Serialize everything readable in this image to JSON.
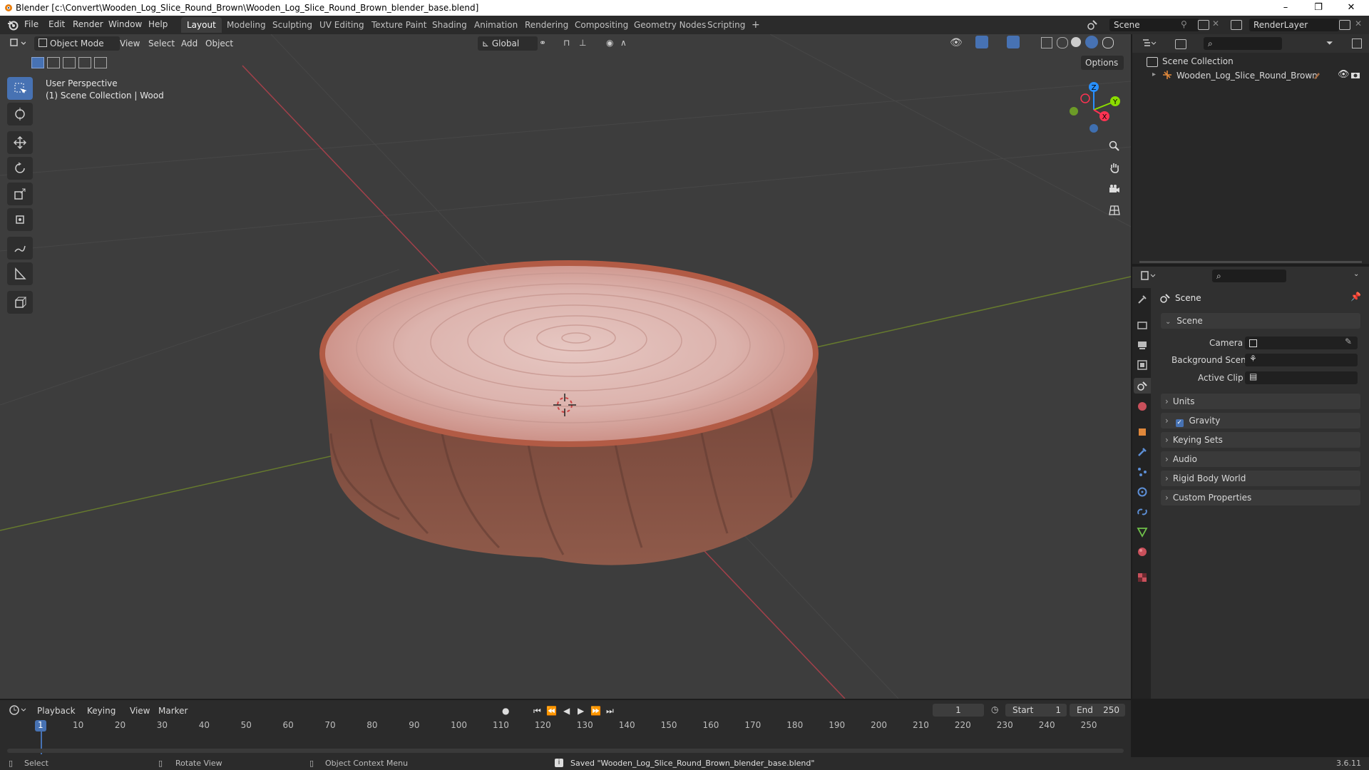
{
  "window": {
    "title": "Blender [c:\\Convert\\Wooden_Log_Slice_Round_Brown\\Wooden_Log_Slice_Round_Brown_blender_base.blend]",
    "minimize": "–",
    "maximize": "❐",
    "close": "✕"
  },
  "menu": [
    "File",
    "Edit",
    "Render",
    "Window",
    "Help"
  ],
  "workspaces": [
    "Layout",
    "Modeling",
    "Sculpting",
    "UV Editing",
    "Texture Paint",
    "Shading",
    "Animation",
    "Rendering",
    "Compositing",
    "Geometry Nodes",
    "Scripting"
  ],
  "workspace_add": "+",
  "scene_name": "Scene",
  "render_layer": "RenderLayer",
  "viewport": {
    "mode": "Object Mode",
    "menus": [
      "View",
      "Select",
      "Add",
      "Object"
    ],
    "transform_orientation": "Global",
    "options": "Options",
    "overlay_line1": "User Perspective",
    "overlay_line2": "(1) Scene Collection | Wood",
    "gizmo": {
      "x": "X",
      "y": "Y",
      "z": "Z"
    }
  },
  "outliner": {
    "collection": "Scene Collection",
    "object": "Wooden_Log_Slice_Round_Brown"
  },
  "properties": {
    "header": "Scene",
    "section": "Scene",
    "fields": [
      {
        "label": "Camera"
      },
      {
        "label": "Background Scene"
      },
      {
        "label": "Active Clip"
      }
    ],
    "panels": [
      "Units",
      "Gravity",
      "Keying Sets",
      "Audio",
      "Rigid Body World",
      "Custom Properties"
    ]
  },
  "timeline": {
    "menus": [
      "Playback",
      "Keying",
      "View",
      "Marker"
    ],
    "current_frame": "1",
    "start_label": "Start",
    "start": "1",
    "end_label": "End",
    "end": "250",
    "ruler": [
      "1",
      "10",
      "20",
      "30",
      "40",
      "50",
      "60",
      "70",
      "80",
      "90",
      "100",
      "110",
      "120",
      "130",
      "140",
      "150",
      "160",
      "170",
      "180",
      "190",
      "200",
      "210",
      "220",
      "230",
      "240",
      "250"
    ]
  },
  "statusbar": {
    "select": "Select",
    "rotate": "Rotate View",
    "context": "Object Context Menu",
    "message": "Saved \"Wooden_Log_Slice_Round_Brown_blender_base.blend\"",
    "version": "3.6.11"
  },
  "colors": {
    "accent": "#4772b3",
    "x_axis": "#ff3352",
    "y_axis": "#8bdc00",
    "z_axis": "#2890ff"
  }
}
